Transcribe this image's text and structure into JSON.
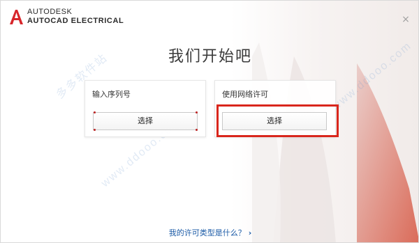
{
  "header": {
    "brand_company": "AUTODESK",
    "brand_product": "AUTOCAD ELECTRICAL",
    "close_symbol": "×"
  },
  "main": {
    "title": "我们开始吧",
    "cards": [
      {
        "label": "输入序列号",
        "button_label": "选择"
      },
      {
        "label": "使用网络许可",
        "button_label": "选择"
      }
    ]
  },
  "footer": {
    "link_text": "我的许可类型是什么？",
    "link_icon": "chevron-right-icon"
  },
  "watermark": {
    "text_left": "多多软件站",
    "text_url": "www.ddooo.com"
  },
  "colors": {
    "logo_red": "#d7262b",
    "highlight_red": "#d9261c",
    "link_blue": "#1a5aa6"
  }
}
